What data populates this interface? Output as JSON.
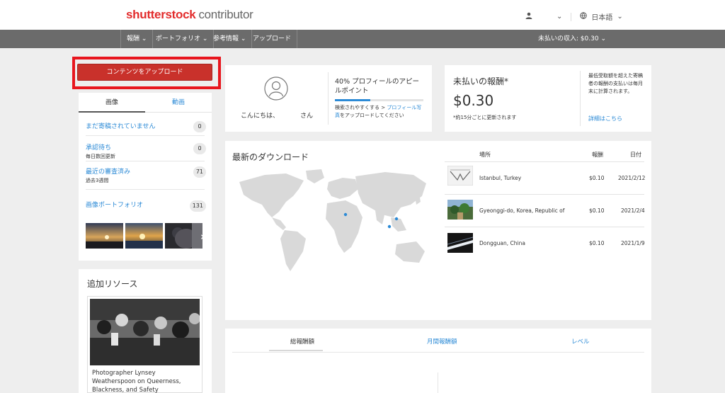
{
  "header": {
    "logo_brand": "shutterstock",
    "logo_sub": "contributor",
    "user_icon": "user-icon",
    "user_caret": "⌄",
    "language": "日本語",
    "language_caret": "⌄"
  },
  "nav": {
    "items": [
      {
        "label": "報酬 ⌄"
      },
      {
        "label": "ポートフォリオ ⌄"
      },
      {
        "label": "参考情報 ⌄"
      },
      {
        "label": "アップロード"
      }
    ],
    "unpaid_earnings": "未払いの収入: $0.30 ⌄"
  },
  "upload_button": "コンテンツをアップロード",
  "left": {
    "tabs": [
      {
        "label": "画像"
      },
      {
        "label": "動画"
      }
    ],
    "stats": [
      {
        "label": "まだ寄稿されていません",
        "sub": "",
        "count": "0"
      },
      {
        "label": "承認待ち",
        "sub": "毎日数回更新",
        "count": "0"
      },
      {
        "label": "最近の審査済み",
        "sub": "過去3週間",
        "count": "71"
      },
      {
        "label": "画像ポートフォリオ",
        "sub": "",
        "count": "131"
      }
    ],
    "thumb_arrow": "›"
  },
  "resources": {
    "title": "追加リソース",
    "article_title": "Photographer Lynsey Weatherspoon on Queerness, Blackness, and Safety"
  },
  "profile": {
    "hello": "こんにちは、",
    "san": "さん",
    "appeal_title": "40% プロフィールのアピールポイント",
    "appeal_progress": 0.4,
    "appeal_desc_prefix": "検索されやすくする > ",
    "appeal_desc_link": "プロフィール写真",
    "appeal_desc_suffix": "をアップロードしてください"
  },
  "earnings": {
    "label": "未払いの報酬*",
    "amount": "$0.30",
    "note": "*約15分ごとに更新されます",
    "min_note": "最低受取額を超えた寄稿者の報酬の支払いは毎月末に計算されます。",
    "details_link": "詳細はこちら"
  },
  "downloads": {
    "title": "最新のダウンロード",
    "headers": {
      "location": "場所",
      "reward": "報酬",
      "date": "日付"
    },
    "rows": [
      {
        "location": "Istanbul, Turkey",
        "reward": "$0.10",
        "date": "2021/2/12"
      },
      {
        "location": "Gyeonggi-do, Korea, Republic of",
        "reward": "$0.10",
        "date": "2021/2/4"
      },
      {
        "location": "Dongguan, China",
        "reward": "$0.10",
        "date": "2021/1/9"
      }
    ]
  },
  "bottom": {
    "tabs": [
      {
        "label": "総報酬額"
      },
      {
        "label": "月間報酬額"
      },
      {
        "label": "レベル"
      }
    ]
  },
  "colors": {
    "brand_red": "#e22b2b",
    "link_blue": "#2b8ad6",
    "nav_gray": "#6b6b6b",
    "highlight_red": "#e8161e"
  }
}
